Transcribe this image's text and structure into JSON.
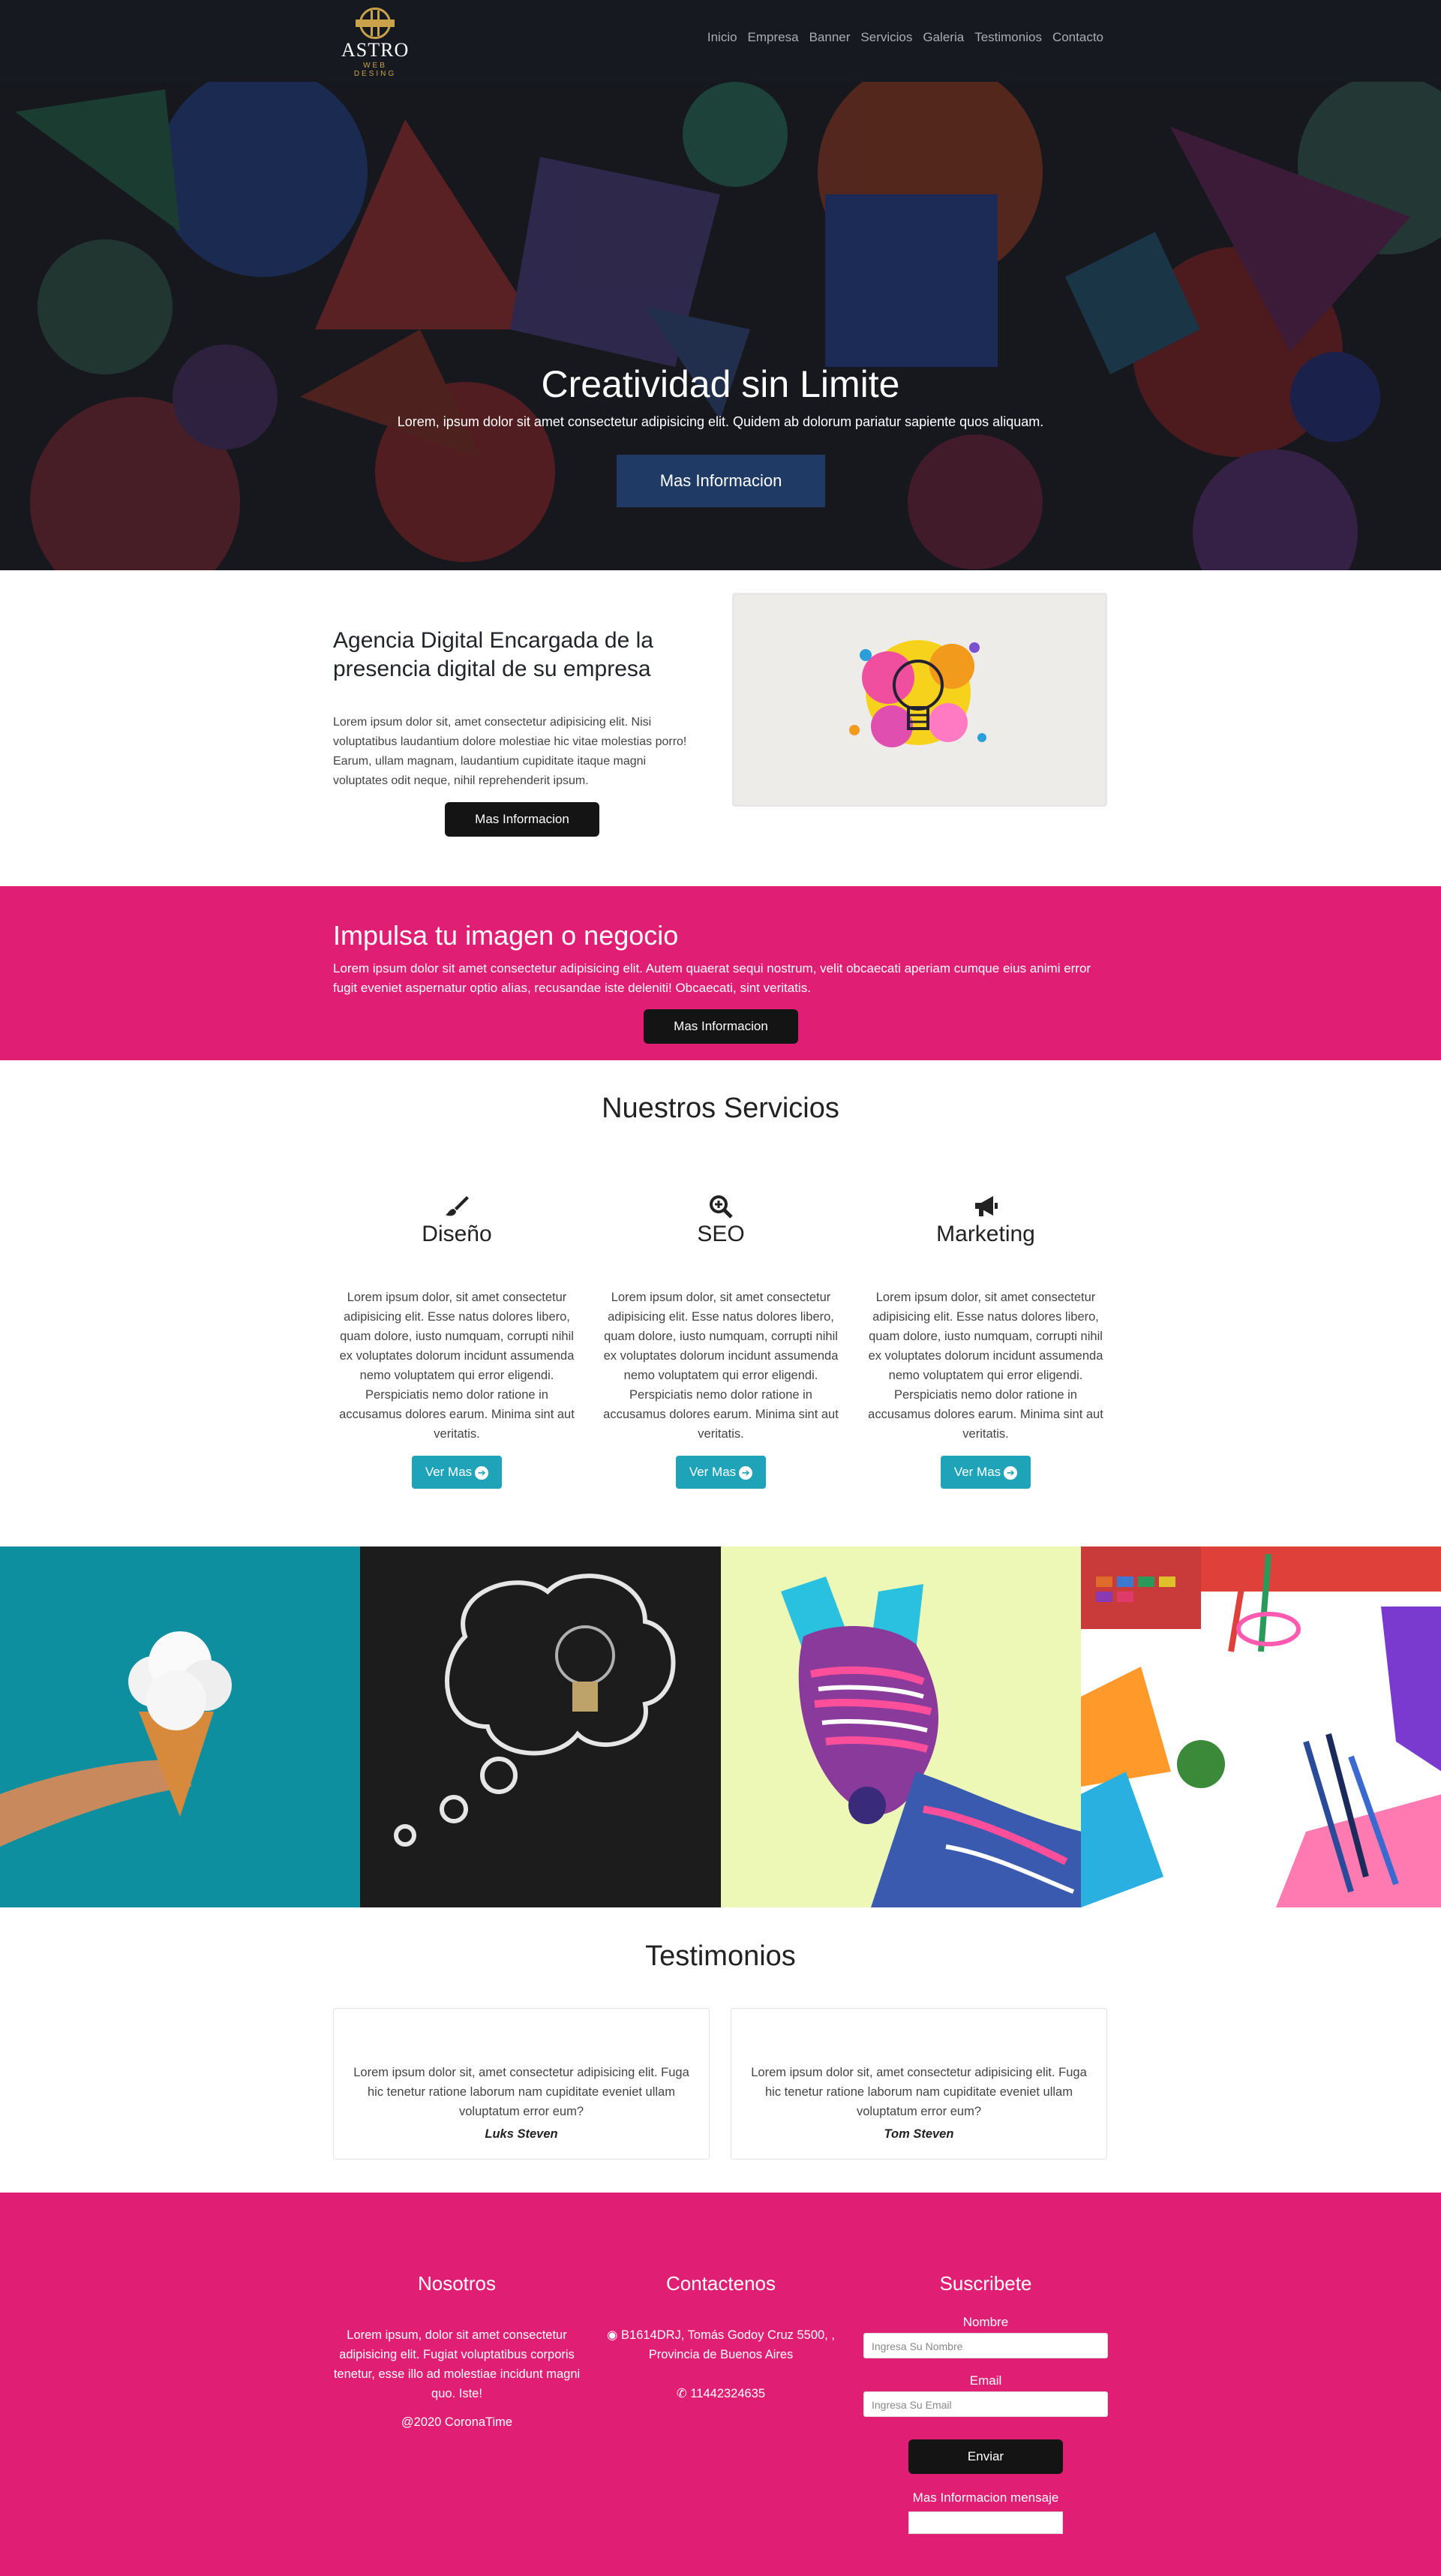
{
  "brand": {
    "name": "ASTRO",
    "tagline": "WEB DESING"
  },
  "nav": [
    "Inicio",
    "Empresa",
    "Banner",
    "Servicios",
    "Galeria",
    "Testimonios",
    "Contacto"
  ],
  "hero": {
    "title": "Creatividad sin Limite",
    "text": "Lorem, ipsum dolor sit amet consectetur adipisicing elit. Quidem ab dolorum pariatur sapiente quos aliquam.",
    "button": "Mas Informacion"
  },
  "about": {
    "title": "Agencia Digital Encargada de la presencia digital de su empresa",
    "text": "Lorem ipsum dolor sit, amet consectetur adipisicing elit. Nisi voluptatibus laudantium dolore molestiae hic vitae molestias porro! Earum, ullam magnam, laudantium cupiditate itaque magni voluptates odit neque, nihil reprehenderit ipsum.",
    "button": "Mas Informacion",
    "image_icon": "lightbulb-paint-splash-image"
  },
  "promo": {
    "title": "Impulsa tu imagen o negocio",
    "text": "Lorem ipsum dolor sit amet consectetur adipisicing elit. Autem quaerat sequi nostrum, velit obcaecati aperiam cumque eius animi error fugit eveniet aspernatur optio alias, recusandae iste deleniti! Obcaecati, sint veritatis.",
    "button": "Mas Informacion"
  },
  "services": {
    "title": "Nuestros Servicios",
    "items": [
      {
        "name": "Diseño",
        "icon": "paintbrush-icon",
        "text": "Lorem ipsum dolor, sit amet consectetur adipisicing elit. Esse natus dolores libero, quam dolore, iusto numquam, corrupti nihil ex voluptates dolorum incidunt assumenda nemo voluptatem qui error eligendi. Perspiciatis nemo dolor ratione in accusamus dolores earum. Minima sint aut veritatis.",
        "button": "Ver Mas"
      },
      {
        "name": "SEO",
        "icon": "search-plus-icon",
        "text": "Lorem ipsum dolor, sit amet consectetur adipisicing elit. Esse natus dolores libero, quam dolore, iusto numquam, corrupti nihil ex voluptates dolorum incidunt assumenda nemo voluptatem qui error eligendi. Perspiciatis nemo dolor ratione in accusamus dolores earum. Minima sint aut veritatis.",
        "button": "Ver Mas"
      },
      {
        "name": "Marketing",
        "icon": "megaphone-icon",
        "text": "Lorem ipsum dolor, sit amet consectetur adipisicing elit. Esse natus dolores libero, quam dolore, iusto numquam, corrupti nihil ex voluptates dolorum incidunt assumenda nemo voluptatem qui error eligendi. Perspiciatis nemo dolor ratione in accusamus dolores earum. Minima sint aut veritatis.",
        "button": "Ver Mas"
      }
    ]
  },
  "gallery": [
    {
      "icon": "hand-cloud-cone-image",
      "bg": "#0e8fa0"
    },
    {
      "icon": "lightbulb-chalk-bubble-image",
      "bg": "#1c1c1c"
    },
    {
      "icon": "colorful-zebra-image",
      "bg": "#eef8b6"
    },
    {
      "icon": "art-supplies-image",
      "bg": "#ffffff"
    }
  ],
  "testimonials": {
    "title": "Testimonios",
    "items": [
      {
        "quote": "Lorem ipsum dolor sit, amet consectetur adipisicing elit. Fuga hic tenetur ratione laborum nam cupiditate eveniet ullam voluptatum error eum?",
        "author": "Luks Steven"
      },
      {
        "quote": "Lorem ipsum dolor sit, amet consectetur adipisicing elit. Fuga hic tenetur ratione laborum nam cupiditate eveniet ullam voluptatum error eum?",
        "author": "Tom Steven"
      }
    ]
  },
  "footer": {
    "about": {
      "title": "Nosotros",
      "text": "Lorem ipsum, dolor sit amet consectetur adipisicing elit. Fugiat voluptatibus corporis tenetur, esse illo ad molestiae incidunt magni quo. Iste!",
      "copyright": "@2020 CoronaTime"
    },
    "contact": {
      "title": "Contactenos",
      "address": "B1614DRJ, Tomás Godoy Cruz 5500, , Provincia de Buenos Aires",
      "phone": "11442324635"
    },
    "subscribe": {
      "title": "Suscribete",
      "name_label": "Nombre",
      "name_placeholder": "Ingresa Su Nombre",
      "email_label": "Email",
      "email_placeholder": "Ingresa Su Email",
      "button": "Enviar",
      "message_label": "Mas Informacion mensaje"
    }
  },
  "colors": {
    "accent": "#e01f74",
    "dark": "#161a20",
    "teal": "#1fa3b8",
    "hero_button": "#1f3a64"
  }
}
